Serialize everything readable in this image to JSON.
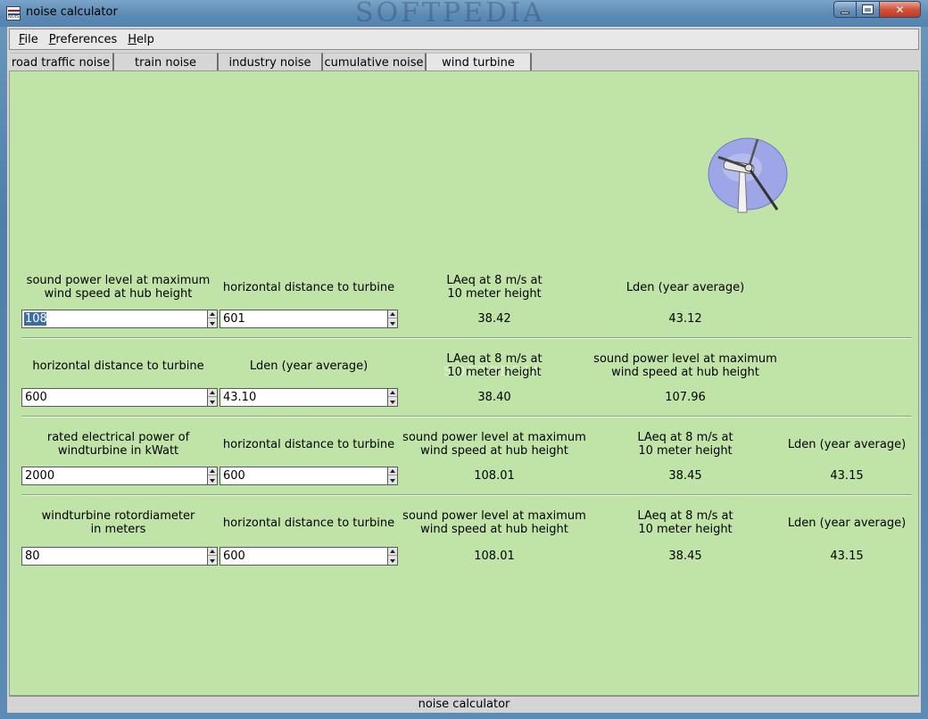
{
  "window": {
    "title": "noise calculator",
    "watermark": "SOFTPEDIA",
    "min_label": "",
    "close_label": "✕"
  },
  "menu": [
    {
      "label": "File",
      "ul": "F",
      "rest": "ile"
    },
    {
      "label": "Preferences",
      "ul": "P",
      "rest": "references"
    },
    {
      "label": "Help",
      "ul": "H",
      "rest": "elp"
    }
  ],
  "tabs": [
    {
      "label": "road traffic noise"
    },
    {
      "label": "train noise"
    },
    {
      "label": "industry noise"
    },
    {
      "label": "cumulative noise"
    },
    {
      "label": "wind turbine"
    }
  ],
  "active_tab": 4,
  "rows": [
    {
      "labels": [
        "sound power level at maximum\nwind speed at hub height",
        "horizontal distance to turbine",
        "LAeq at 8 m/s at\n10 meter height",
        "Lden (year average)",
        ""
      ],
      "inputs": [
        "108",
        "601"
      ],
      "outputs": [
        "38.42",
        "43.12",
        ""
      ]
    },
    {
      "labels": [
        "horizontal distance to turbine",
        "Lden (year average)",
        "LAeq at 8 m/s at\n10 meter height",
        "sound power level at maximum\nwind speed at hub height",
        ""
      ],
      "inputs": [
        "600",
        "43.10"
      ],
      "outputs": [
        "38.40",
        "107.96",
        ""
      ]
    },
    {
      "labels": [
        "rated electrical power of\nwindturbine in kWatt",
        "horizontal distance to turbine",
        "sound power level at maximum\nwind speed at hub height",
        "LAeq at 8 m/s at\n10 meter height",
        "Lden (year average)"
      ],
      "inputs": [
        "2000",
        "600"
      ],
      "outputs": [
        "108.01",
        "38.45",
        "43.15"
      ]
    },
    {
      "labels": [
        "windturbine rotordiameter\nin meters",
        "horizontal distance to turbine",
        "sound power level at maximum\nwind speed at hub height",
        "LAeq at 8 m/s at\n10 meter height",
        "Lden (year average)"
      ],
      "inputs": [
        "80",
        "600"
      ],
      "outputs": [
        "108.01",
        "38.45",
        "43.15"
      ]
    }
  ],
  "status": "noise calculator",
  "colors": {
    "content_bg": "#c0e4a8",
    "selection": "#3a6ea5"
  }
}
